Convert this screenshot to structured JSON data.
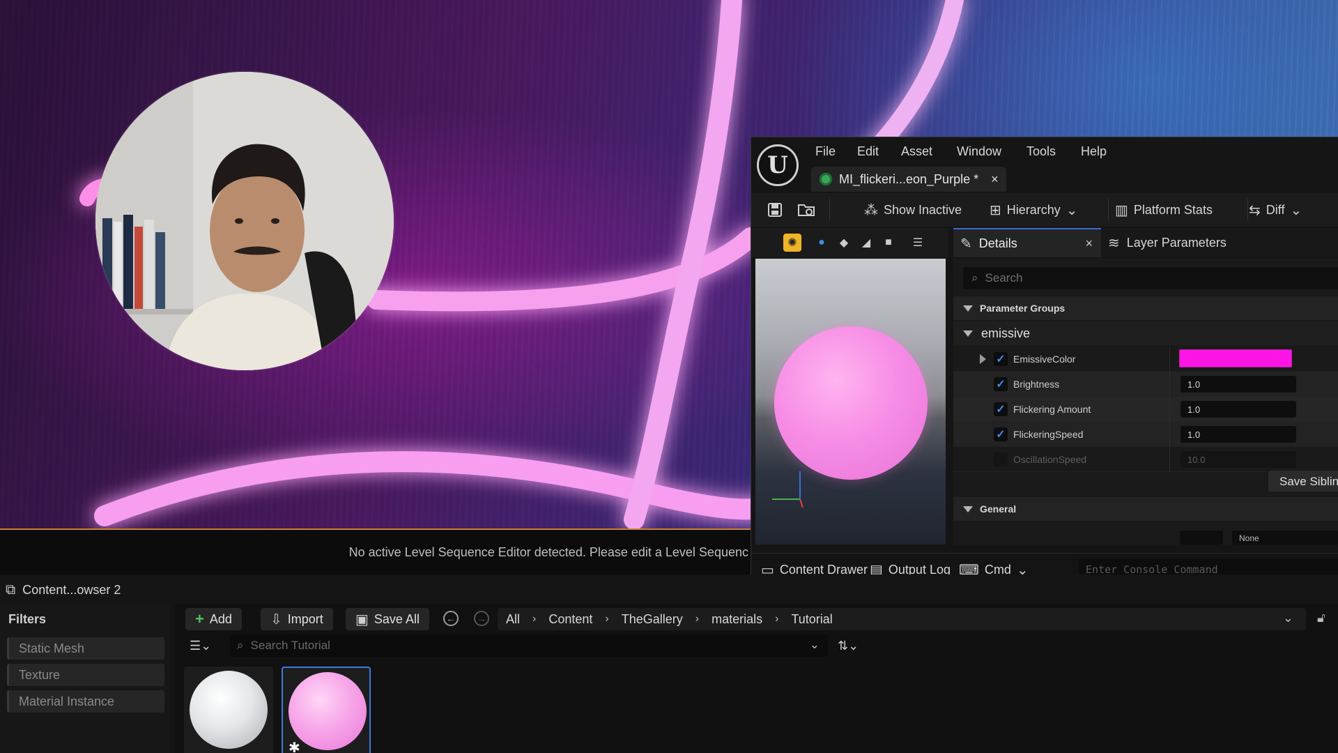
{
  "menu": {
    "logo": "U",
    "items": [
      "File",
      "Edit",
      "Asset",
      "Window",
      "Tools",
      "Help"
    ]
  },
  "asset_tab": {
    "label": "MI_flickeri...eon_Purple *",
    "close": "×"
  },
  "toolbar": {
    "show_inactive": "Show Inactive",
    "hierarchy": "Hierarchy",
    "platform_stats": "Platform Stats",
    "diff": "Diff"
  },
  "details": {
    "tab_label": "Details",
    "tab_close": "×",
    "layer_tab": "Layer Parameters",
    "search_placeholder": "Search",
    "parameter_groups": "Parameter Groups",
    "group_name": "emissive",
    "params": [
      {
        "name": "EmissiveColor",
        "enabled": true,
        "value": ""
      },
      {
        "name": "Brightness",
        "enabled": true,
        "value": "1.0"
      },
      {
        "name": "Flickering Amount",
        "enabled": true,
        "value": "1.0"
      },
      {
        "name": "FlickeringSpeed",
        "enabled": true,
        "value": "1.0"
      },
      {
        "name": "OscillationSpeed",
        "enabled": false,
        "value": "10.0"
      }
    ],
    "emissive_color": "#ff14e6",
    "save_siblings": "Save Siblin",
    "general": "General",
    "general_value": "None"
  },
  "status": {
    "content_drawer": "Content Drawer",
    "output_log": "Output Log",
    "cmd": "Cmd",
    "console_placeholder": "Enter Console Command"
  },
  "sequencer_message": "No active Level Sequence Editor detected. Please edit a Level Sequenc",
  "content_browser": {
    "tab_label": "Content...owser 2",
    "filters_title": "Filters",
    "filters": [
      "Static Mesh",
      "Texture",
      "Material Instance"
    ],
    "add": "Add",
    "import": "Import",
    "save_all": "Save All",
    "breadcrumb": [
      "All",
      "Content",
      "TheGallery",
      "materials",
      "Tutorial"
    ],
    "search_placeholder": "Search Tutorial"
  }
}
